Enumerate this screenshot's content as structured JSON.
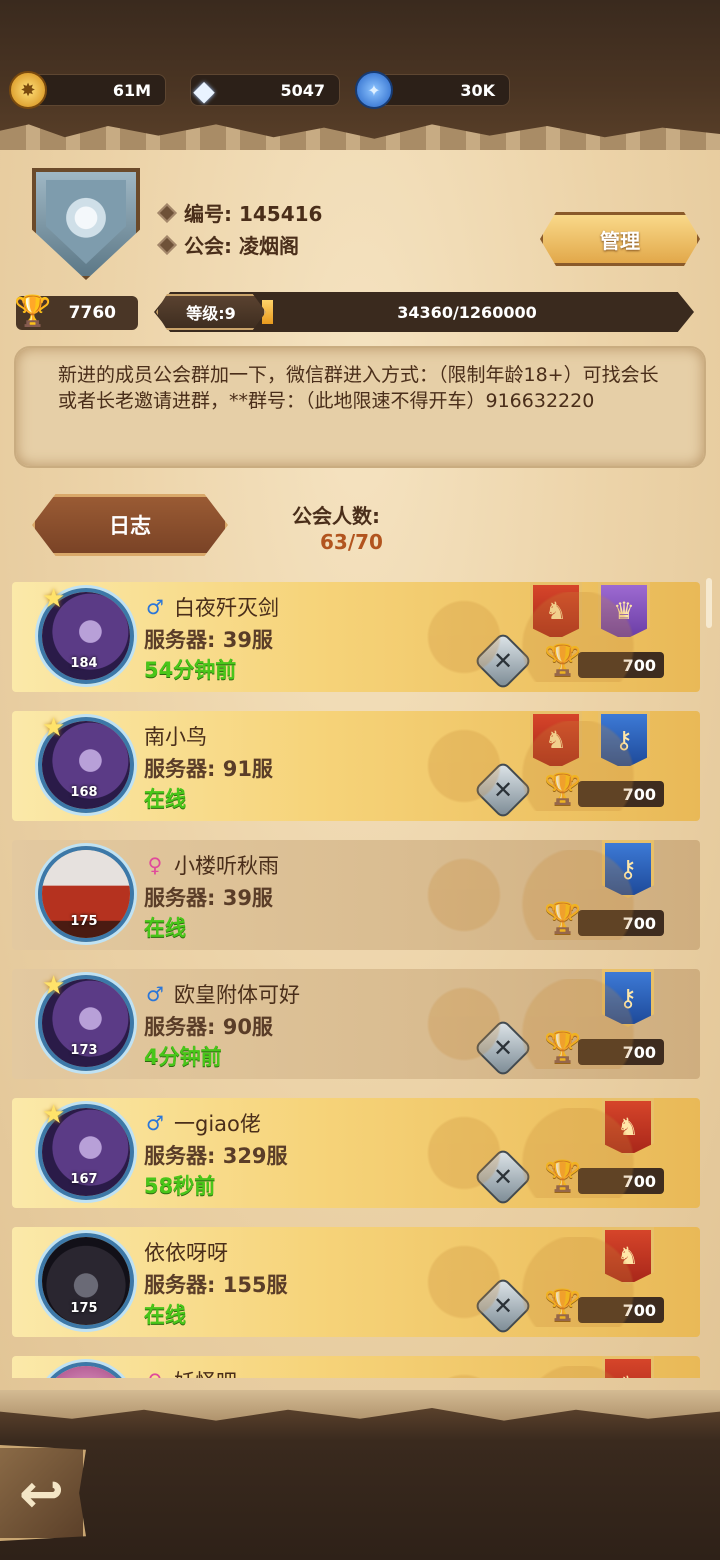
{
  "currencies": {
    "gold": {
      "icon": "gold-coin-icon",
      "value": "61M"
    },
    "diamond": {
      "icon": "diamond-icon",
      "value": "5047"
    },
    "potion": {
      "icon": "blue-potion-icon",
      "value": "30K"
    }
  },
  "guild": {
    "id_label": "编号: 145416",
    "name_label": "公会: 凌烟阁",
    "manage_label": "管理",
    "trophies": "7760",
    "level_label": "等级:9",
    "exp_text": "34360/1260000",
    "exp_fraction": 0.0273,
    "notice": "新进的成员公会群加一下，微信群进入方式：（限制年龄18+）可找会长或者长老邀请进群，**群号：（此地限速不得开车）916632220"
  },
  "log_label": "日志",
  "members_label": "公会人数:",
  "members_count": "63/70",
  "members": [
    {
      "name": "白夜歼灭剑",
      "gender": "male",
      "server": "服务器: 39服",
      "status": "54分钟前",
      "level": "184",
      "avatar": "purple",
      "star": true,
      "swords": true,
      "points": "700",
      "banners": [
        "red",
        "purple"
      ]
    },
    {
      "name": "南小鸟",
      "gender": "",
      "server": "服务器: 91服",
      "status": "在线",
      "level": "168",
      "avatar": "purple",
      "star": true,
      "swords": true,
      "points": "700",
      "banners": [
        "red",
        "blue"
      ]
    },
    {
      "name": "小楼听秋雨",
      "gender": "female",
      "server": "服务器: 39服",
      "status": "在线",
      "level": "175",
      "avatar": "red",
      "star": false,
      "swords": false,
      "points": "700",
      "banners": [
        "blue"
      ]
    },
    {
      "name": "欧皇附体可好",
      "gender": "male",
      "server": "服务器: 90服",
      "status": "4分钟前",
      "level": "173",
      "avatar": "purple",
      "star": true,
      "swords": true,
      "points": "700",
      "banners": [
        "blue"
      ]
    },
    {
      "name": "一giao佬",
      "gender": "male",
      "server": "服务器: 329服",
      "status": "58秒前",
      "level": "167",
      "avatar": "purple",
      "star": true,
      "swords": true,
      "points": "700",
      "banners": [
        "red"
      ]
    },
    {
      "name": "依依呀呀",
      "gender": "",
      "server": "服务器: 155服",
      "status": "在线",
      "level": "175",
      "avatar": "dark",
      "star": false,
      "swords": true,
      "points": "700",
      "banners": [
        "red"
      ]
    },
    {
      "name": "妖怪吧",
      "gender": "female",
      "server": "",
      "status": "",
      "level": "",
      "avatar": "pink",
      "star": false,
      "swords": false,
      "points": "",
      "banners": [
        "red"
      ]
    }
  ]
}
